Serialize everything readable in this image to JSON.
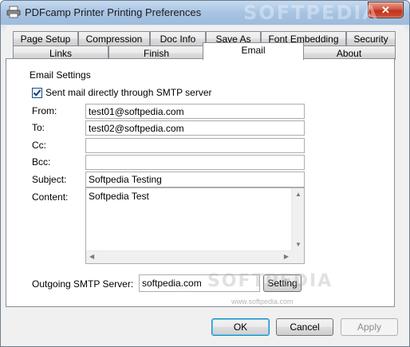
{
  "window": {
    "title": "PDFcamp Printer Printing Preferences",
    "close_glyph": "✕"
  },
  "tabs_row1": [
    "Page Setup",
    "Compression",
    "Doc Info",
    "Save As",
    "Font Embedding",
    "Security"
  ],
  "tabs_row2": [
    "Links",
    "Finish",
    "Email",
    "About"
  ],
  "active_tab": "Email",
  "email": {
    "group_title": "Email Settings",
    "smtp_direct_label": "Sent mail directly through SMTP server",
    "smtp_direct_checked": true,
    "labels": {
      "from": "From:",
      "to": "To:",
      "cc": "Cc:",
      "bcc": "Bcc:",
      "subject": "Subject:",
      "content": "Content:",
      "smtp_server": "Outgoing SMTP Server:"
    },
    "values": {
      "from": "test01@softpedia.com",
      "to": "test02@softpedia.com",
      "cc": "",
      "bcc": "",
      "subject": "Softpedia Testing",
      "content": "Softpedia Test",
      "smtp_server": "softpedia.com"
    },
    "setting_button": "Setting"
  },
  "buttons": {
    "ok": "OK",
    "cancel": "Cancel",
    "apply": "Apply"
  },
  "watermarks": {
    "brand_title": "SOFTPEDIA",
    "brand_body": "SOFTPEDIA",
    "url": "www.softpedia.com"
  },
  "colors": {
    "title_bar": "#a7c3e2",
    "close_button": "#c0321e",
    "default_button_border": "#3c7fb1"
  }
}
